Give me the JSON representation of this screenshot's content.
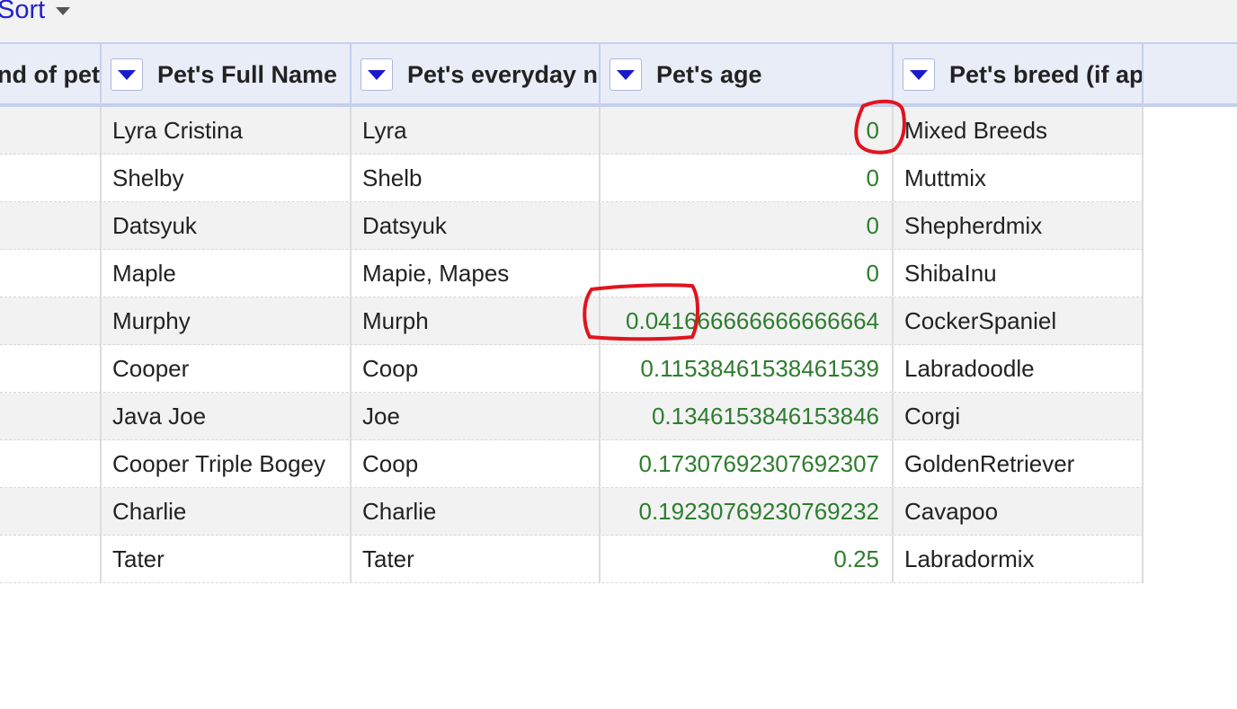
{
  "toolbar": {
    "sort_label": "Sort"
  },
  "columns": [
    {
      "label": "nd of pet"
    },
    {
      "label": "Pet's Full Name"
    },
    {
      "label": "Pet's everyday n"
    },
    {
      "label": "Pet's age"
    },
    {
      "label": "Pet's breed (if ap"
    }
  ],
  "rows": [
    {
      "full_name": "Lyra Cristina",
      "everyday_name": "Lyra",
      "age": "0",
      "breed": "Mixed Breeds"
    },
    {
      "full_name": "Shelby",
      "everyday_name": "Shelb",
      "age": "0",
      "breed": "Muttmix"
    },
    {
      "full_name": "Datsyuk",
      "everyday_name": "Datsyuk",
      "age": "0",
      "breed": "Shepherdmix"
    },
    {
      "full_name": "Maple",
      "everyday_name": "Mapie, Mapes",
      "age": "0",
      "breed": "ShibaInu"
    },
    {
      "full_name": "Murphy",
      "everyday_name": "Murph",
      "age": "0.041666666666666664",
      "breed": "CockerSpaniel"
    },
    {
      "full_name": "Cooper",
      "everyday_name": "Coop",
      "age": "0.11538461538461539",
      "breed": "Labradoodle"
    },
    {
      "full_name": "Java Joe",
      "everyday_name": "Joe",
      "age": "0.1346153846153846",
      "breed": "Corgi"
    },
    {
      "full_name": "Cooper Triple Bogey",
      "everyday_name": "Coop",
      "age": "0.17307692307692307",
      "breed": "GoldenRetriever"
    },
    {
      "full_name": "Charlie",
      "everyday_name": "Charlie",
      "age": "0.19230769230769232",
      "breed": "Cavapoo"
    },
    {
      "full_name": "Tater",
      "everyday_name": "Tater",
      "age": "0.25",
      "breed": "Labradormix"
    }
  ],
  "colors": {
    "accent": "#2222cc",
    "number": "#2e7d2e",
    "annotation": "#e0141e",
    "header_bg": "#e8edf8"
  }
}
